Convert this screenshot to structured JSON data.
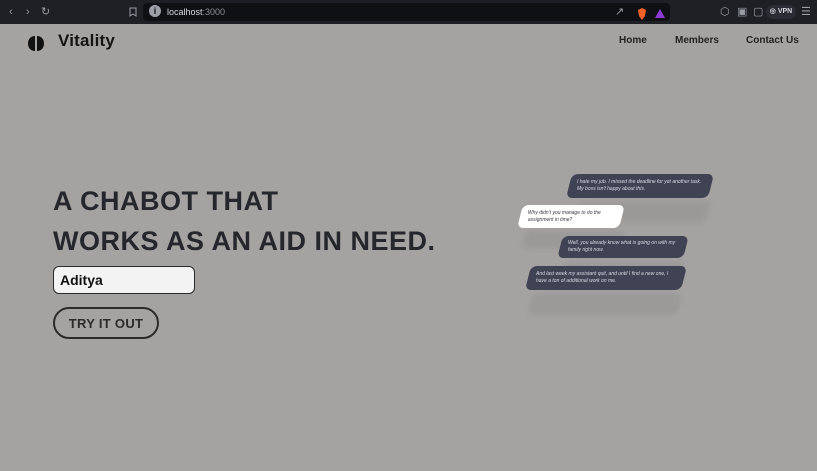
{
  "browser": {
    "url_host": "localhost",
    "url_port": ":3000",
    "vpn_label": "VPN"
  },
  "site": {
    "brand": "Vitality",
    "nav": [
      "Home",
      "Members",
      "Contact Us"
    ]
  },
  "hero": {
    "line1": "A CHABOT THAT",
    "line2": "WORKS AS AN AID IN NEED.",
    "name_value": "Aditya",
    "button_label": "TRY IT OUT"
  },
  "chat": [
    "I hate my job. I missed the deadline for yet another task. My boss isn't happy about this.",
    "Why didn't you manage to do the assignment in time?",
    "Well, you already know what is going on with my family right now.",
    "And last week my assistant quit, and until I find a new one, I have a ton of additional work on me."
  ],
  "colors": {
    "page_bg": "#a5a3a2",
    "bubble_dark": "#3f4354",
    "bubble_light": "#ffffff",
    "browser_chrome": "#1f2026"
  }
}
